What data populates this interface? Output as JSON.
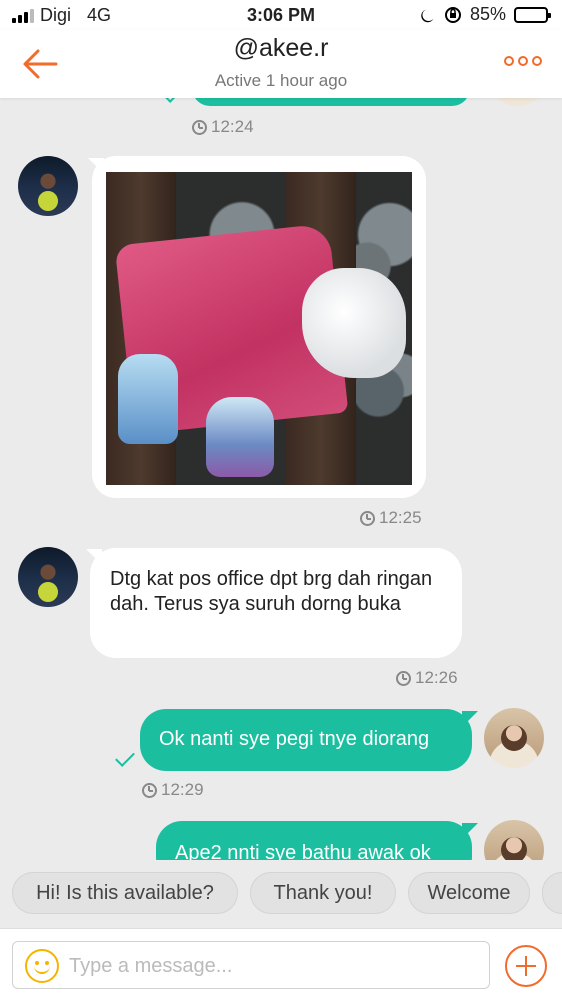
{
  "status_bar": {
    "carrier": "Digi",
    "network": "4G",
    "time": "3:06 PM",
    "battery": "85%",
    "battery_level": 0.85,
    "icons": [
      "signal-icon",
      "moon-icon",
      "orientation-lock-icon",
      "battery-icon"
    ]
  },
  "header": {
    "title": "@akee.r",
    "subtitle": "Active 1 hour ago",
    "back_icon": "back-arrow-icon",
    "more_icon": "more-icon"
  },
  "messages": [
    {
      "from": "self",
      "text": "",
      "time": "12:24"
    },
    {
      "from": "other",
      "type": "image",
      "time": "12:25"
    },
    {
      "from": "other",
      "text": "Dtg kat pos office dpt brg dah ringan dah. Terus sya suruh dorng buka",
      "time": "12:26"
    },
    {
      "from": "self",
      "text": "Ok nanti sye pegi tnye diorang",
      "time": "12:29"
    },
    {
      "from": "self",
      "text": "Ape2 nnti sye bathu awak ok",
      "time": ""
    }
  ],
  "quick_replies": [
    "Hi! Is this available?",
    "Thank you!",
    "Welcome"
  ],
  "composer": {
    "placeholder": "Type a message...",
    "value": "",
    "emoji_icon": "smiley-icon",
    "add_icon": "plus-icon"
  },
  "colors": {
    "accent": "#f26b2a",
    "outgoing_bubble": "#1bbfa0",
    "incoming_bubble": "#ffffff",
    "background": "#ebebeb"
  }
}
